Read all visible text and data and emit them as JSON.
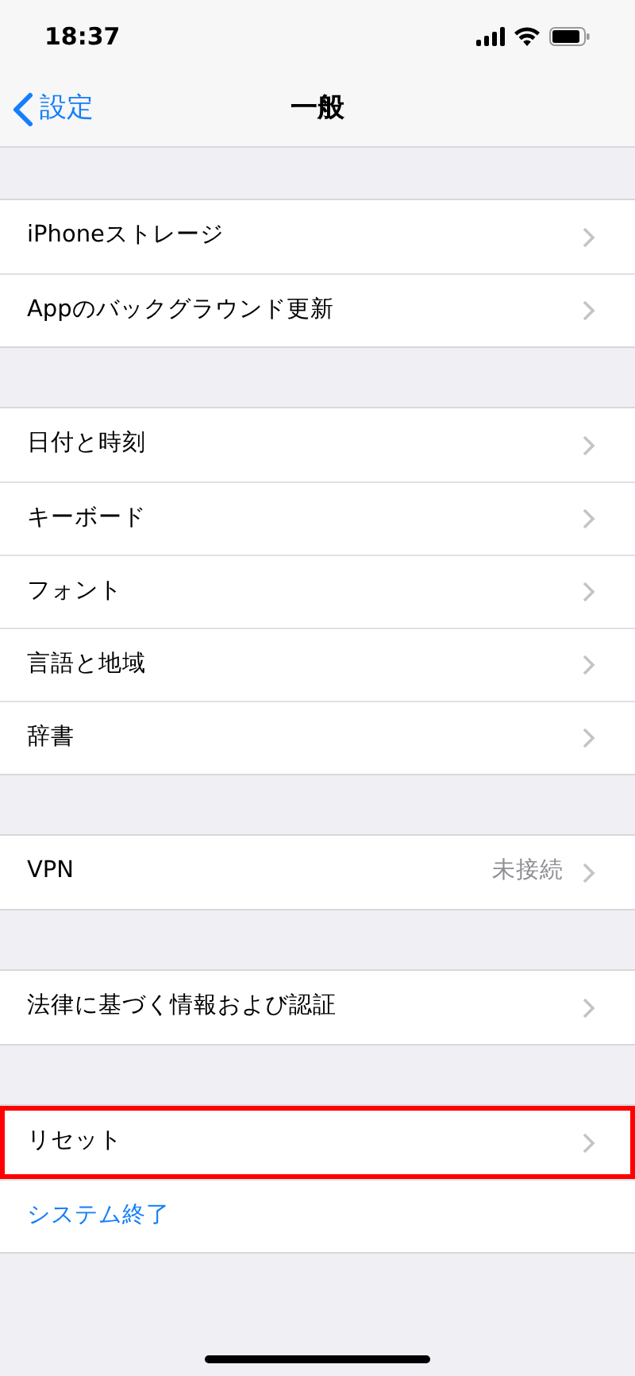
{
  "status_bar": {
    "time": "18:37"
  },
  "nav_bar": {
    "back": "設定",
    "title": "一般"
  },
  "groups": [
    {
      "rows": [
        {
          "kind": "nav",
          "label": "iPhoneストレージ",
          "highlighted": false
        },
        {
          "kind": "nav",
          "label": "Appのバックグラウンド更新",
          "highlighted": false
        }
      ]
    },
    {
      "rows": [
        {
          "kind": "nav",
          "label": "日付と時刻",
          "highlighted": false
        },
        {
          "kind": "nav",
          "label": "キーボード",
          "highlighted": false
        },
        {
          "kind": "nav",
          "label": "フォント",
          "highlighted": false
        },
        {
          "kind": "nav",
          "label": "言語と地域",
          "highlighted": false
        },
        {
          "kind": "nav",
          "label": "辞書",
          "highlighted": false
        }
      ]
    },
    {
      "rows": [
        {
          "kind": "nav",
          "label": "VPN",
          "value": "未接続",
          "highlighted": false
        }
      ]
    },
    {
      "rows": [
        {
          "kind": "nav",
          "label": "法律に基づく情報および認証",
          "highlighted": false
        }
      ]
    },
    {
      "rows": [
        {
          "kind": "nav",
          "label": "リセット",
          "highlighted": true
        },
        {
          "kind": "action",
          "label": "システム終了",
          "highlighted": false
        }
      ]
    }
  ]
}
